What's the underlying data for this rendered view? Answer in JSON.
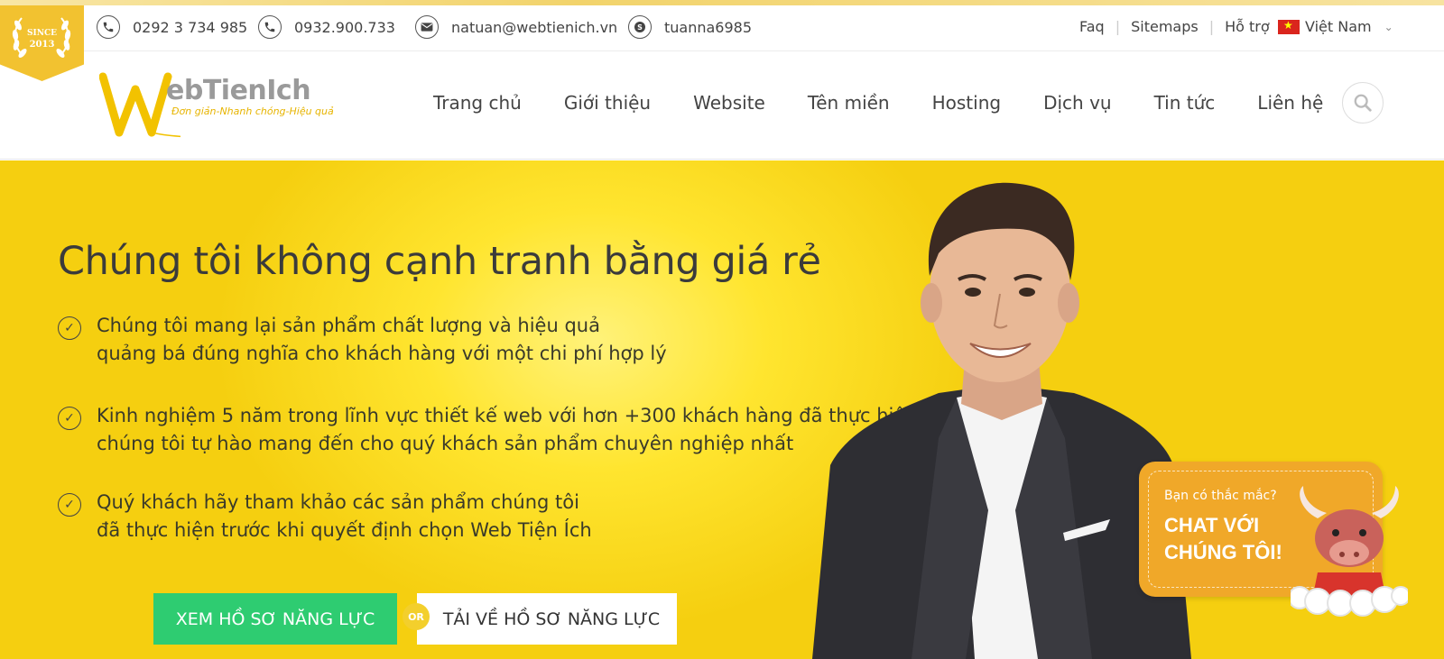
{
  "topbar": {
    "badge": {
      "line1": "SINCE",
      "line2": "2013"
    },
    "contacts": [
      {
        "icon": "phone-icon",
        "text": "0292 3 734 985"
      },
      {
        "icon": "phone-icon",
        "text": "0932.900.733"
      },
      {
        "icon": "mail-icon",
        "text": "natuan@webtienich.vn"
      },
      {
        "icon": "skype-icon",
        "text": "tuanna6985"
      }
    ],
    "links": [
      "Faq",
      "Sitemaps",
      "Hỗ trợ"
    ],
    "language": "Việt Nam"
  },
  "header": {
    "logo": {
      "text": "ebTienIch",
      "slogan": "Đơn giản-Nhanh chóng-Hiệu quả"
    },
    "nav": [
      "Trang chủ",
      "Giới thiệu",
      "Website",
      "Tên miền",
      "Hosting",
      "Dịch vụ",
      "Tin tức",
      "Liên hệ"
    ]
  },
  "hero": {
    "title": "Chúng tôi không cạnh tranh bằng giá rẻ",
    "features": [
      {
        "line1": "Chúng tôi mang lại sản phẩm chất lượng và hiệu quả",
        "line2": "quảng bá đúng nghĩa cho khách hàng với một chi phí hợp lý"
      },
      {
        "line1": "Kinh nghiệm 5 năm trong lĩnh vực thiết kế web với hơn +300 khách hàng đã thực hiện",
        "line2": "chúng tôi tự hào mang đến cho quý khách sản phẩm chuyên nghiệp nhất"
      },
      {
        "line1": "Quý khách hãy tham khảo các sản phẩm chúng tôi",
        "line2": "đã thực hiện trước khi quyết định chọn Web Tiện Ích"
      }
    ],
    "primary_button": "XEM HỒ SƠ NĂNG LỰC",
    "or_label": "OR",
    "secondary_button": "TẢI VỀ HỒ SƠ NĂNG LỰC"
  },
  "chat": {
    "question": "Bạn có thắc mắc?",
    "cta_line1": "CHAT VỚI",
    "cta_line2": "CHÚNG TÔI!"
  },
  "colors": {
    "brand_yellow": "#f5cf10",
    "green": "#2ecc71",
    "chat_orange": "#f0a829"
  }
}
